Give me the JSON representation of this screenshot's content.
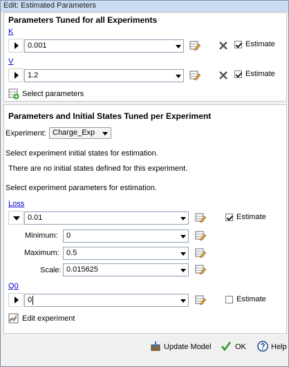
{
  "window": {
    "title": "Edit: Estimated Parameters"
  },
  "global_section": {
    "title": "Parameters Tuned for all Experiments",
    "params": [
      {
        "name": "K",
        "value": "0.001",
        "estimate_label": "Estimate",
        "estimate_checked": true
      },
      {
        "name": "V",
        "value": "1.2",
        "estimate_label": "Estimate",
        "estimate_checked": true
      }
    ],
    "select_params_label": "Select parameters"
  },
  "experiment_section": {
    "title": "Parameters and Initial States Tuned per Experiment",
    "experiment_label": "Experiment:",
    "experiment_value": "Charge_Exp",
    "states_prompt": "Select experiment initial states for estimation.",
    "states_note": "There are no initial states defined for this experiment.",
    "params_prompt": "Select experiment parameters for estimation.",
    "loss": {
      "name": "Loss",
      "value": "0.01",
      "estimate_label": "Estimate",
      "estimate_checked": true,
      "minimum_label": "Minimum:",
      "minimum_value": "0",
      "maximum_label": "Maximum:",
      "maximum_value": "0.5",
      "scale_label": "Scale:",
      "scale_value": "0.015625"
    },
    "q0": {
      "name": "Q0",
      "value": "0",
      "estimate_label": "Estimate",
      "estimate_checked": false
    },
    "edit_experiment_label": "Edit experiment"
  },
  "footer": {
    "update_model_label": "Update Model",
    "ok_label": "OK",
    "help_label": "Help"
  },
  "colors": {
    "link": "#0000cc",
    "titlebar": "#c9dcf2",
    "panel_bg": "#ffffff",
    "window_bg": "#f0f0f0"
  }
}
